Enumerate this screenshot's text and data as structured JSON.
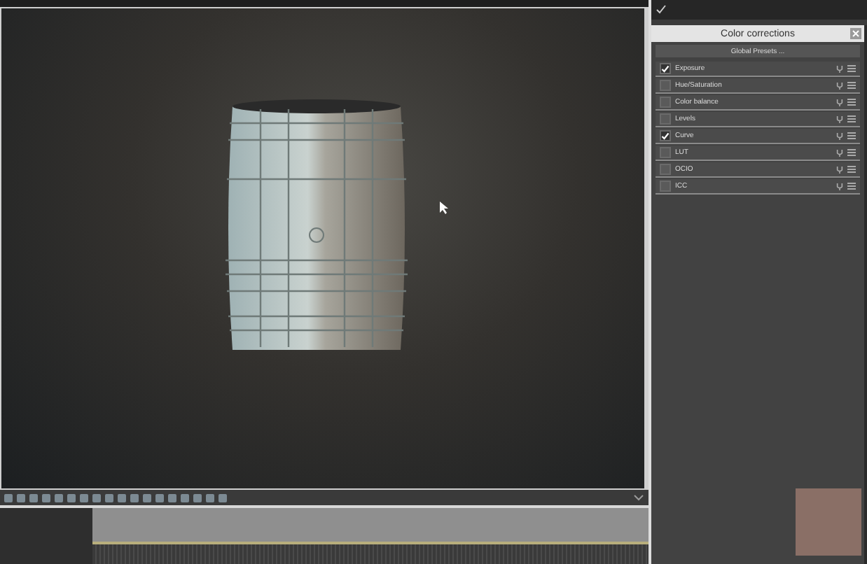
{
  "panel": {
    "title": "Color corrections",
    "presets_button": "Global Presets ...",
    "items": [
      {
        "label": "Exposure",
        "checked": true
      },
      {
        "label": "Hue/Saturation",
        "checked": false
      },
      {
        "label": "Color balance",
        "checked": false
      },
      {
        "label": "Levels",
        "checked": false
      },
      {
        "label": "Curve",
        "checked": true
      },
      {
        "label": "LUT",
        "checked": false
      },
      {
        "label": "OCIO",
        "checked": false
      },
      {
        "label": "ICC",
        "checked": false
      }
    ]
  }
}
